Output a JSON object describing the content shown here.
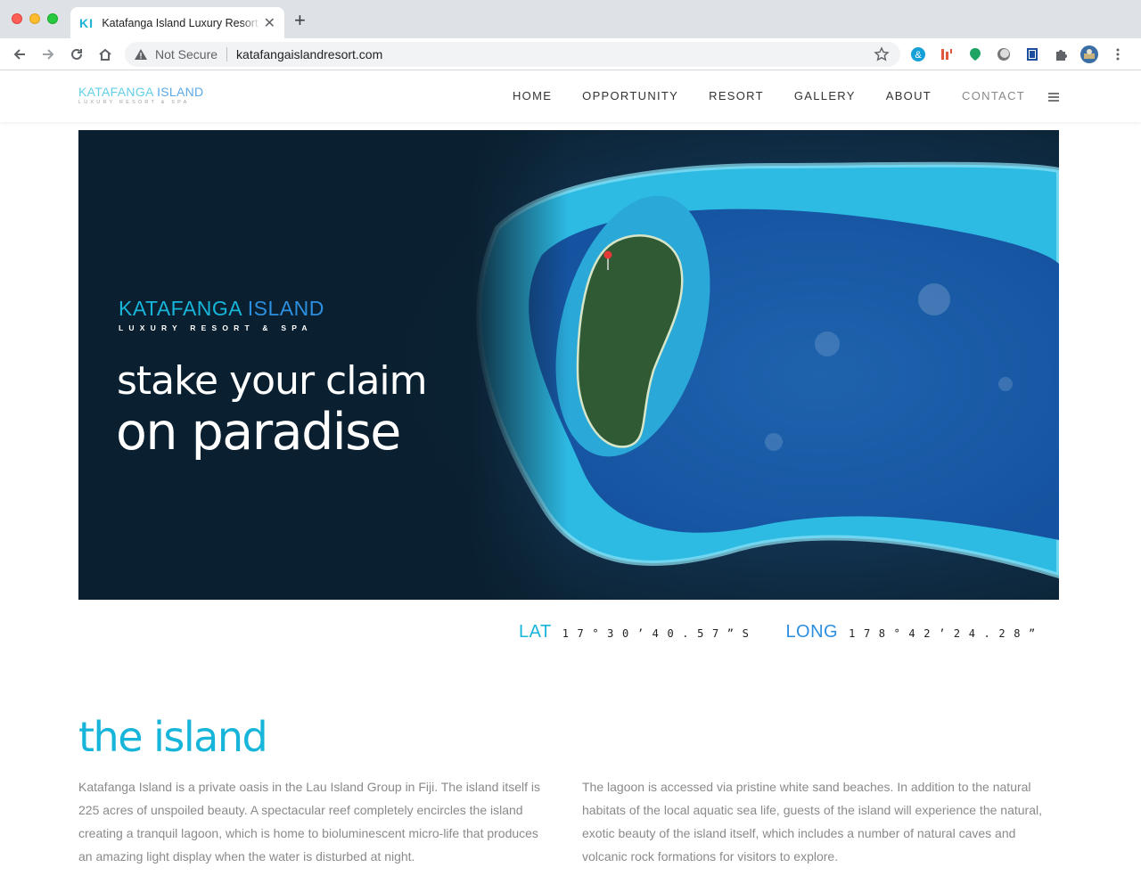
{
  "browser": {
    "tab_title": "Katafanga Island Luxury Resort & Spa",
    "tab_favicon": "KI",
    "security_label": "Not Secure",
    "url": "katafangaislandresort.com"
  },
  "site": {
    "logo": {
      "word1": "KATAFANGA",
      "word2": "ISLAND",
      "tagline": "LUXURY RESORT & SPA"
    },
    "nav": [
      "HOME",
      "OPPORTUNITY",
      "RESORT",
      "GALLERY",
      "ABOUT",
      "CONTACT"
    ]
  },
  "hero": {
    "brand_word1": "KATAFANGA",
    "brand_word2": "ISLAND",
    "brand_tagline": "LUXURY RESORT & SPA",
    "tagline_line1": "stake your claim",
    "tagline_line2": "on paradise"
  },
  "coordinates": {
    "lat_label": "LAT",
    "lat_value": "17°30’40.57”S",
    "long_label": "LONG",
    "long_value": "178°42’24.28”"
  },
  "island": {
    "title": "the island",
    "para_left": "Katafanga Island is a private oasis in the Lau Island Group in Fiji. The island itself is 225 acres of unspoiled beauty. A spectacular reef completely encircles the island creating a tranquil lagoon, which is home to bioluminescent micro-life that produces an amazing light display when the water is disturbed at night.",
    "para_right": "The lagoon is accessed via pristine white sand beaches. In addition to the natural habitats of the local aquatic sea life, guests of the island will experience the natural, exotic beauty of the island itself, which includes a number of natural caves and volcanic rock formations for visitors to explore."
  },
  "colors": {
    "accent_cyan": "#17b5d9",
    "accent_blue": "#2c8fe0",
    "hero_dark": "#0b2233"
  }
}
